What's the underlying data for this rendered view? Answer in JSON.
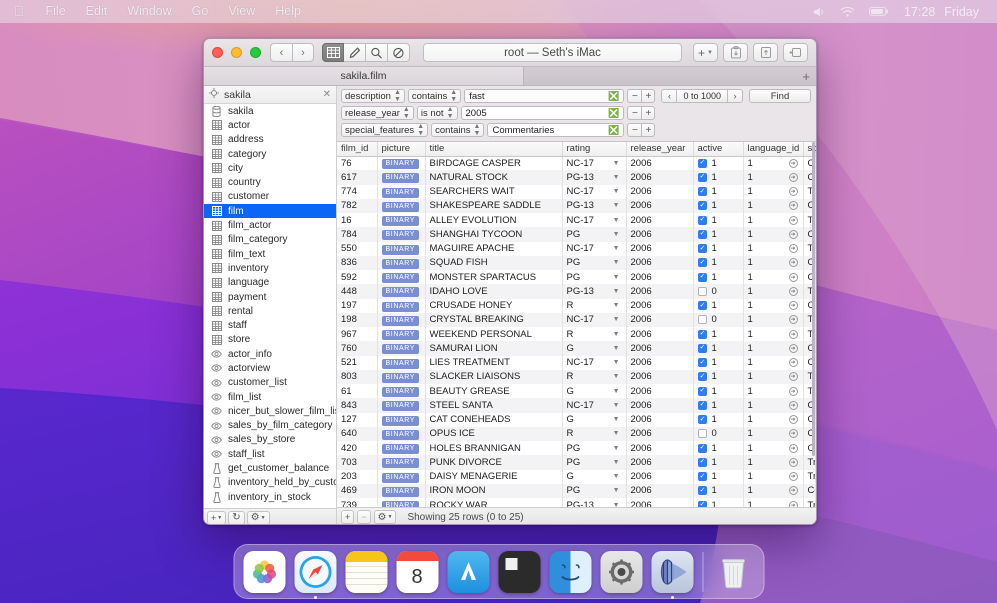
{
  "menubar": {
    "apple": "",
    "items": [
      "File",
      "Edit",
      "Window",
      "Go",
      "View",
      "Help"
    ],
    "status_icons": [
      "volume-icon",
      "wifi-icon",
      "battery-icon"
    ],
    "clock": "17:28",
    "day": "Friday"
  },
  "window": {
    "title": "root — Seth's iMac",
    "traffic_lights": [
      "close",
      "minimize",
      "zoom"
    ],
    "nav": {
      "back": "‹",
      "forward": "›"
    },
    "view_buttons": [
      "table-view-icon",
      "structure-icon",
      "query-search-icon",
      "relations-icon"
    ],
    "toolbar_right": [
      "add-button",
      "import-icon",
      "export-icon",
      "info-icon"
    ],
    "add_label": "+",
    "tab": {
      "label": "sakila.film",
      "new_tab": "+"
    }
  },
  "sidebar": {
    "search_value": "sakila",
    "search_clear": "✕",
    "target_icon": "target-icon",
    "items": [
      {
        "label": "sakila",
        "icon": "database-icon",
        "selected": false
      },
      {
        "label": "actor",
        "icon": "table-icon",
        "selected": false
      },
      {
        "label": "address",
        "icon": "table-icon",
        "selected": false
      },
      {
        "label": "category",
        "icon": "table-icon",
        "selected": false
      },
      {
        "label": "city",
        "icon": "table-icon",
        "selected": false
      },
      {
        "label": "country",
        "icon": "table-icon",
        "selected": false
      },
      {
        "label": "customer",
        "icon": "table-icon",
        "selected": false
      },
      {
        "label": "film",
        "icon": "table-icon",
        "selected": true
      },
      {
        "label": "film_actor",
        "icon": "table-icon",
        "selected": false
      },
      {
        "label": "film_category",
        "icon": "table-icon",
        "selected": false
      },
      {
        "label": "film_text",
        "icon": "table-icon",
        "selected": false
      },
      {
        "label": "inventory",
        "icon": "table-icon",
        "selected": false
      },
      {
        "label": "language",
        "icon": "table-icon",
        "selected": false
      },
      {
        "label": "payment",
        "icon": "table-icon",
        "selected": false
      },
      {
        "label": "rental",
        "icon": "table-icon",
        "selected": false
      },
      {
        "label": "staff",
        "icon": "table-icon",
        "selected": false
      },
      {
        "label": "store",
        "icon": "table-icon",
        "selected": false
      },
      {
        "label": "actor_info",
        "icon": "view-eye-icon",
        "selected": false
      },
      {
        "label": "actorview",
        "icon": "view-eye-icon",
        "selected": false
      },
      {
        "label": "customer_list",
        "icon": "view-eye-icon",
        "selected": false
      },
      {
        "label": "film_list",
        "icon": "view-eye-icon",
        "selected": false
      },
      {
        "label": "nicer_but_slower_film_list",
        "icon": "view-eye-icon",
        "selected": false
      },
      {
        "label": "sales_by_film_category",
        "icon": "view-eye-icon",
        "selected": false
      },
      {
        "label": "sales_by_store",
        "icon": "view-eye-icon",
        "selected": false
      },
      {
        "label": "staff_list",
        "icon": "view-eye-icon",
        "selected": false
      },
      {
        "label": "get_customer_balance",
        "icon": "function-icon",
        "selected": false
      },
      {
        "label": "inventory_held_by_custom…",
        "icon": "function-icon",
        "selected": false
      },
      {
        "label": "inventory_in_stock",
        "icon": "function-icon",
        "selected": false
      }
    ],
    "footer_buttons": [
      "add-database-button",
      "refresh-button",
      "settings-button"
    ]
  },
  "filters": {
    "rows": [
      {
        "field": "description",
        "operator": "contains",
        "value": "fast"
      },
      {
        "field": "release_year",
        "operator": "is not",
        "value": "2005"
      },
      {
        "field": "special_features",
        "operator": "contains",
        "value": "Commentaries"
      }
    ],
    "pager": {
      "prev": "‹",
      "range": "0 to 1000",
      "next": "›"
    },
    "find_label": "Find"
  },
  "table": {
    "columns": [
      "film_id",
      "picture",
      "title",
      "rating",
      "release_year",
      "active",
      "language_id",
      "special_features"
    ],
    "binary_label": "BINARY",
    "rows": [
      {
        "film_id": "76",
        "picture": "BINARY",
        "title": "BIRDCAGE CASPER",
        "rating": "NC-17",
        "release_year": "2006",
        "active": "1",
        "active_checked": true,
        "language_id": "1",
        "special_features": "Commentaries,Dele"
      },
      {
        "film_id": "617",
        "picture": "BINARY",
        "title": "NATURAL STOCK",
        "rating": "PG-13",
        "release_year": "2006",
        "active": "1",
        "active_checked": true,
        "language_id": "1",
        "special_features": "Commentaries,Dele"
      },
      {
        "film_id": "774",
        "picture": "BINARY",
        "title": "SEARCHERS WAIT",
        "rating": "NC-17",
        "release_year": "2006",
        "active": "1",
        "active_checked": true,
        "language_id": "1",
        "special_features": "Trailers,Commentar"
      },
      {
        "film_id": "782",
        "picture": "BINARY",
        "title": "SHAKESPEARE SADDLE",
        "rating": "PG-13",
        "release_year": "2006",
        "active": "1",
        "active_checked": true,
        "language_id": "1",
        "special_features": "Commentaries,Behi"
      },
      {
        "film_id": "16",
        "picture": "BINARY",
        "title": "ALLEY EVOLUTION",
        "rating": "NC-17",
        "release_year": "2006",
        "active": "1",
        "active_checked": true,
        "language_id": "1",
        "special_features": "Trailers,Commentar"
      },
      {
        "film_id": "784",
        "picture": "BINARY",
        "title": "SHANGHAI TYCOON",
        "rating": "PG",
        "release_year": "2006",
        "active": "1",
        "active_checked": true,
        "language_id": "1",
        "special_features": "Commentaries,Dele"
      },
      {
        "film_id": "550",
        "picture": "BINARY",
        "title": "MAGUIRE APACHE",
        "rating": "NC-17",
        "release_year": "2006",
        "active": "1",
        "active_checked": true,
        "language_id": "1",
        "special_features": "Trailers,Commentar"
      },
      {
        "film_id": "836",
        "picture": "BINARY",
        "title": "SQUAD FISH",
        "rating": "PG",
        "release_year": "2006",
        "active": "1",
        "active_checked": true,
        "language_id": "1",
        "special_features": "Commentaries,Dele"
      },
      {
        "film_id": "592",
        "picture": "BINARY",
        "title": "MONSTER SPARTACUS",
        "rating": "PG",
        "release_year": "2006",
        "active": "1",
        "active_checked": true,
        "language_id": "1",
        "special_features": "Commentaries,Behi"
      },
      {
        "film_id": "448",
        "picture": "BINARY",
        "title": "IDAHO LOVE",
        "rating": "PG-13",
        "release_year": "2006",
        "active": "0",
        "active_checked": false,
        "language_id": "1",
        "special_features": "Trailers,Commentar"
      },
      {
        "film_id": "197",
        "picture": "BINARY",
        "title": "CRUSADE HONEY",
        "rating": "R",
        "release_year": "2006",
        "active": "1",
        "active_checked": true,
        "language_id": "1",
        "special_features": "Commentaries"
      },
      {
        "film_id": "198",
        "picture": "BINARY",
        "title": "CRYSTAL BREAKING",
        "rating": "NC-17",
        "release_year": "2006",
        "active": "0",
        "active_checked": false,
        "language_id": "1",
        "special_features": "Trailers,Commentar"
      },
      {
        "film_id": "967",
        "picture": "BINARY",
        "title": "WEEKEND PERSONAL",
        "rating": "R",
        "release_year": "2006",
        "active": "1",
        "active_checked": true,
        "language_id": "1",
        "special_features": "Trailers,Commentar"
      },
      {
        "film_id": "760",
        "picture": "BINARY",
        "title": "SAMURAI LION",
        "rating": "G",
        "release_year": "2006",
        "active": "1",
        "active_checked": true,
        "language_id": "1",
        "special_features": "Commentaries"
      },
      {
        "film_id": "521",
        "picture": "BINARY",
        "title": "LIES TREATMENT",
        "rating": "NC-17",
        "release_year": "2006",
        "active": "1",
        "active_checked": true,
        "language_id": "1",
        "special_features": "Commentaries,Dele"
      },
      {
        "film_id": "803",
        "picture": "BINARY",
        "title": "SLACKER LIAISONS",
        "rating": "R",
        "release_year": "2006",
        "active": "1",
        "active_checked": true,
        "language_id": "1",
        "special_features": "Trailers,Commentar"
      },
      {
        "film_id": "61",
        "picture": "BINARY",
        "title": "BEAUTY GREASE",
        "rating": "G",
        "release_year": "2006",
        "active": "1",
        "active_checked": true,
        "language_id": "1",
        "special_features": "Trailers,Commentar"
      },
      {
        "film_id": "843",
        "picture": "BINARY",
        "title": "STEEL SANTA",
        "rating": "NC-17",
        "release_year": "2006",
        "active": "1",
        "active_checked": true,
        "language_id": "1",
        "special_features": "Commentaries,Dele"
      },
      {
        "film_id": "127",
        "picture": "BINARY",
        "title": "CAT CONEHEADS",
        "rating": "G",
        "release_year": "2006",
        "active": "1",
        "active_checked": true,
        "language_id": "1",
        "special_features": "Commentaries,Dele"
      },
      {
        "film_id": "640",
        "picture": "BINARY",
        "title": "OPUS ICE",
        "rating": "R",
        "release_year": "2006",
        "active": "0",
        "active_checked": false,
        "language_id": "1",
        "special_features": "Commentaries,Dele"
      },
      {
        "film_id": "420",
        "picture": "BINARY",
        "title": "HOLES BRANNIGAN",
        "rating": "PG",
        "release_year": "2006",
        "active": "1",
        "active_checked": true,
        "language_id": "1",
        "special_features": "Commentaries,Behi"
      },
      {
        "film_id": "703",
        "picture": "BINARY",
        "title": "PUNK DIVORCE",
        "rating": "PG",
        "release_year": "2006",
        "active": "1",
        "active_checked": true,
        "language_id": "1",
        "special_features": "Trailers,Commentar"
      },
      {
        "film_id": "203",
        "picture": "BINARY",
        "title": "DAISY MENAGERIE",
        "rating": "G",
        "release_year": "2006",
        "active": "1",
        "active_checked": true,
        "language_id": "1",
        "special_features": "Trailers,Commentar"
      },
      {
        "film_id": "469",
        "picture": "BINARY",
        "title": "IRON MOON",
        "rating": "PG",
        "release_year": "2006",
        "active": "1",
        "active_checked": true,
        "language_id": "1",
        "special_features": "Commentaries,Behi"
      },
      {
        "film_id": "739",
        "picture": "BINARY",
        "title": "ROCKY WAR",
        "rating": "PG-13",
        "release_year": "2006",
        "active": "1",
        "active_checked": true,
        "language_id": "1",
        "special_features": "Trailers,Commentar"
      }
    ]
  },
  "statusbar": {
    "buttons": [
      "add-row-button",
      "delete-row-button",
      "row-settings-button"
    ],
    "status": "Showing 25 rows (0 to 25)"
  },
  "dock": {
    "items": [
      {
        "name": "photos",
        "running": false
      },
      {
        "name": "safari",
        "running": true
      },
      {
        "name": "notes",
        "running": false
      },
      {
        "name": "calendar",
        "day": "8",
        "running": false
      },
      {
        "name": "app-store",
        "running": false
      },
      {
        "name": "terminal",
        "running": false
      },
      {
        "name": "finder",
        "running": false
      },
      {
        "name": "system-preferences",
        "running": false
      },
      {
        "name": "sequel-pro",
        "running": true
      }
    ],
    "trash": "trash"
  },
  "colors": {
    "accent": "#0a67f5",
    "checkbox": "#2f7cf6",
    "binary_badge": "#7b8ed1"
  }
}
